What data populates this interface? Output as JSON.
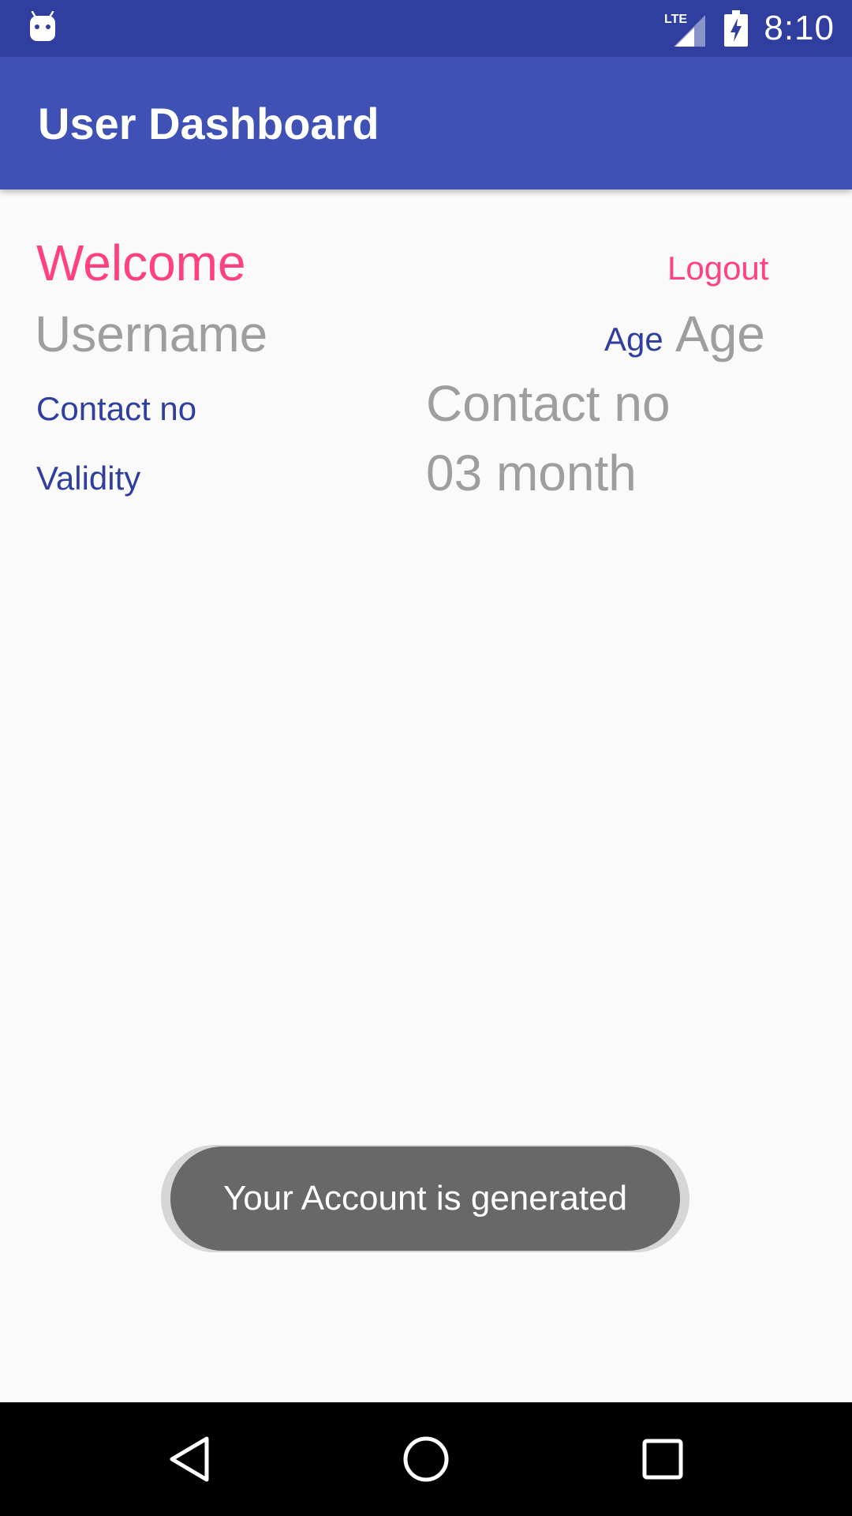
{
  "status_bar": {
    "time": "8:10",
    "network": "LTE",
    "icons": [
      "android-debug-icon",
      "lte-signal-icon",
      "battery-charging-icon"
    ]
  },
  "app_bar": {
    "title": "User Dashboard"
  },
  "dashboard": {
    "welcome": "Welcome",
    "logout": "Logout",
    "username": "Username",
    "age_label": "Age",
    "age_value": "Age",
    "contact_label": "Contact no",
    "contact_value": "Contact no",
    "validity_label": "Validity",
    "validity_value": "03 month"
  },
  "toast": {
    "message": "Your Account is generated"
  },
  "navigation": {
    "icons": [
      "back-icon",
      "home-icon",
      "recents-icon"
    ]
  },
  "colors": {
    "primary": "#3f51b5",
    "primary_dark": "#303f9f",
    "accent": "#ff4081",
    "hint_text": "#9e9e9e",
    "toast_bg": "#686868"
  }
}
